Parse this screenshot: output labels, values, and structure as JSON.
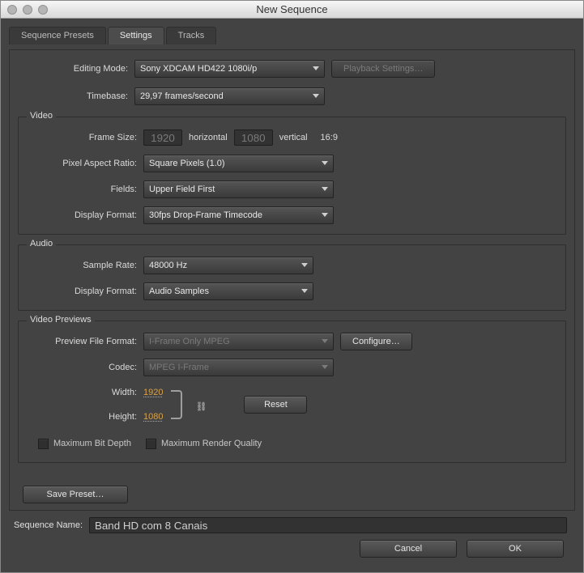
{
  "window_title": "New Sequence",
  "tabs": {
    "presets": "Sequence Presets",
    "settings": "Settings",
    "tracks": "Tracks"
  },
  "top": {
    "editing_mode_label": "Editing Mode:",
    "editing_mode": "Sony XDCAM HD422 1080i/p",
    "playback_btn": "Playback Settings…",
    "timebase_label": "Timebase:",
    "timebase": "29,97 frames/second"
  },
  "video": {
    "legend": "Video",
    "frame_size_label": "Frame Size:",
    "width": "1920",
    "horizontal": "horizontal",
    "height": "1080",
    "vertical": "vertical",
    "aspect": "16:9",
    "par_label": "Pixel Aspect Ratio:",
    "par": "Square Pixels (1.0)",
    "fields_label": "Fields:",
    "fields": "Upper Field First",
    "display_label": "Display Format:",
    "display": "30fps Drop-Frame Timecode"
  },
  "audio": {
    "legend": "Audio",
    "sr_label": "Sample Rate:",
    "sr": "48000 Hz",
    "display_label": "Display Format:",
    "display": "Audio Samples"
  },
  "previews": {
    "legend": "Video Previews",
    "pff_label": "Preview File Format:",
    "pff": "I-Frame Only MPEG",
    "configure_btn": "Configure…",
    "codec_label": "Codec:",
    "codec": "MPEG I-Frame",
    "width_label": "Width:",
    "width": "1920",
    "height_label": "Height:",
    "height": "1080",
    "reset_btn": "Reset",
    "max_bit": "Maximum Bit Depth",
    "max_rq": "Maximum Render Quality"
  },
  "save_preset_btn": "Save Preset…",
  "seqname_label": "Sequence Name:",
  "seqname": "Band HD com 8 Canais",
  "cancel": "Cancel",
  "ok": "OK"
}
